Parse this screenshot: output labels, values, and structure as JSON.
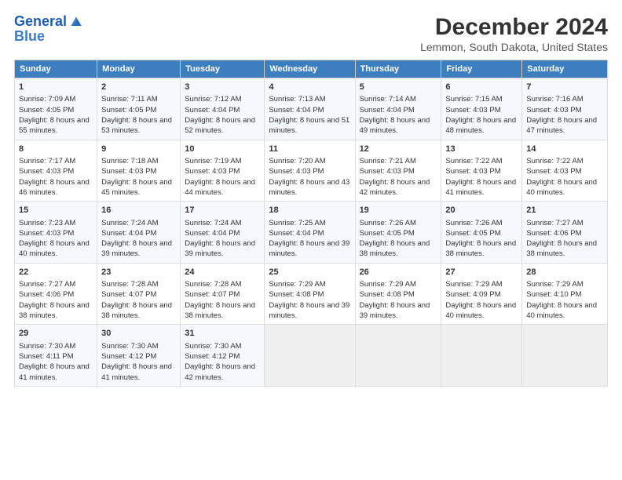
{
  "logo": {
    "line1": "General",
    "line2": "Blue"
  },
  "title": "December 2024",
  "subtitle": "Lemmon, South Dakota, United States",
  "days_of_week": [
    "Sunday",
    "Monday",
    "Tuesday",
    "Wednesday",
    "Thursday",
    "Friday",
    "Saturday"
  ],
  "weeks": [
    [
      {
        "day": "1",
        "sunrise": "Sunrise: 7:09 AM",
        "sunset": "Sunset: 4:05 PM",
        "daylight": "Daylight: 8 hours and 55 minutes."
      },
      {
        "day": "2",
        "sunrise": "Sunrise: 7:11 AM",
        "sunset": "Sunset: 4:05 PM",
        "daylight": "Daylight: 8 hours and 53 minutes."
      },
      {
        "day": "3",
        "sunrise": "Sunrise: 7:12 AM",
        "sunset": "Sunset: 4:04 PM",
        "daylight": "Daylight: 8 hours and 52 minutes."
      },
      {
        "day": "4",
        "sunrise": "Sunrise: 7:13 AM",
        "sunset": "Sunset: 4:04 PM",
        "daylight": "Daylight: 8 hours and 51 minutes."
      },
      {
        "day": "5",
        "sunrise": "Sunrise: 7:14 AM",
        "sunset": "Sunset: 4:04 PM",
        "daylight": "Daylight: 8 hours and 49 minutes."
      },
      {
        "day": "6",
        "sunrise": "Sunrise: 7:15 AM",
        "sunset": "Sunset: 4:03 PM",
        "daylight": "Daylight: 8 hours and 48 minutes."
      },
      {
        "day": "7",
        "sunrise": "Sunrise: 7:16 AM",
        "sunset": "Sunset: 4:03 PM",
        "daylight": "Daylight: 8 hours and 47 minutes."
      }
    ],
    [
      {
        "day": "8",
        "sunrise": "Sunrise: 7:17 AM",
        "sunset": "Sunset: 4:03 PM",
        "daylight": "Daylight: 8 hours and 46 minutes."
      },
      {
        "day": "9",
        "sunrise": "Sunrise: 7:18 AM",
        "sunset": "Sunset: 4:03 PM",
        "daylight": "Daylight: 8 hours and 45 minutes."
      },
      {
        "day": "10",
        "sunrise": "Sunrise: 7:19 AM",
        "sunset": "Sunset: 4:03 PM",
        "daylight": "Daylight: 8 hours and 44 minutes."
      },
      {
        "day": "11",
        "sunrise": "Sunrise: 7:20 AM",
        "sunset": "Sunset: 4:03 PM",
        "daylight": "Daylight: 8 hours and 43 minutes."
      },
      {
        "day": "12",
        "sunrise": "Sunrise: 7:21 AM",
        "sunset": "Sunset: 4:03 PM",
        "daylight": "Daylight: 8 hours and 42 minutes."
      },
      {
        "day": "13",
        "sunrise": "Sunrise: 7:22 AM",
        "sunset": "Sunset: 4:03 PM",
        "daylight": "Daylight: 8 hours and 41 minutes."
      },
      {
        "day": "14",
        "sunrise": "Sunrise: 7:22 AM",
        "sunset": "Sunset: 4:03 PM",
        "daylight": "Daylight: 8 hours and 40 minutes."
      }
    ],
    [
      {
        "day": "15",
        "sunrise": "Sunrise: 7:23 AM",
        "sunset": "Sunset: 4:03 PM",
        "daylight": "Daylight: 8 hours and 40 minutes."
      },
      {
        "day": "16",
        "sunrise": "Sunrise: 7:24 AM",
        "sunset": "Sunset: 4:04 PM",
        "daylight": "Daylight: 8 hours and 39 minutes."
      },
      {
        "day": "17",
        "sunrise": "Sunrise: 7:24 AM",
        "sunset": "Sunset: 4:04 PM",
        "daylight": "Daylight: 8 hours and 39 minutes."
      },
      {
        "day": "18",
        "sunrise": "Sunrise: 7:25 AM",
        "sunset": "Sunset: 4:04 PM",
        "daylight": "Daylight: 8 hours and 39 minutes."
      },
      {
        "day": "19",
        "sunrise": "Sunrise: 7:26 AM",
        "sunset": "Sunset: 4:05 PM",
        "daylight": "Daylight: 8 hours and 38 minutes."
      },
      {
        "day": "20",
        "sunrise": "Sunrise: 7:26 AM",
        "sunset": "Sunset: 4:05 PM",
        "daylight": "Daylight: 8 hours and 38 minutes."
      },
      {
        "day": "21",
        "sunrise": "Sunrise: 7:27 AM",
        "sunset": "Sunset: 4:06 PM",
        "daylight": "Daylight: 8 hours and 38 minutes."
      }
    ],
    [
      {
        "day": "22",
        "sunrise": "Sunrise: 7:27 AM",
        "sunset": "Sunset: 4:06 PM",
        "daylight": "Daylight: 8 hours and 38 minutes."
      },
      {
        "day": "23",
        "sunrise": "Sunrise: 7:28 AM",
        "sunset": "Sunset: 4:07 PM",
        "daylight": "Daylight: 8 hours and 38 minutes."
      },
      {
        "day": "24",
        "sunrise": "Sunrise: 7:28 AM",
        "sunset": "Sunset: 4:07 PM",
        "daylight": "Daylight: 8 hours and 38 minutes."
      },
      {
        "day": "25",
        "sunrise": "Sunrise: 7:29 AM",
        "sunset": "Sunset: 4:08 PM",
        "daylight": "Daylight: 8 hours and 39 minutes."
      },
      {
        "day": "26",
        "sunrise": "Sunrise: 7:29 AM",
        "sunset": "Sunset: 4:08 PM",
        "daylight": "Daylight: 8 hours and 39 minutes."
      },
      {
        "day": "27",
        "sunrise": "Sunrise: 7:29 AM",
        "sunset": "Sunset: 4:09 PM",
        "daylight": "Daylight: 8 hours and 40 minutes."
      },
      {
        "day": "28",
        "sunrise": "Sunrise: 7:29 AM",
        "sunset": "Sunset: 4:10 PM",
        "daylight": "Daylight: 8 hours and 40 minutes."
      }
    ],
    [
      {
        "day": "29",
        "sunrise": "Sunrise: 7:30 AM",
        "sunset": "Sunset: 4:11 PM",
        "daylight": "Daylight: 8 hours and 41 minutes."
      },
      {
        "day": "30",
        "sunrise": "Sunrise: 7:30 AM",
        "sunset": "Sunset: 4:12 PM",
        "daylight": "Daylight: 8 hours and 41 minutes."
      },
      {
        "day": "31",
        "sunrise": "Sunrise: 7:30 AM",
        "sunset": "Sunset: 4:12 PM",
        "daylight": "Daylight: 8 hours and 42 minutes."
      },
      null,
      null,
      null,
      null
    ]
  ]
}
